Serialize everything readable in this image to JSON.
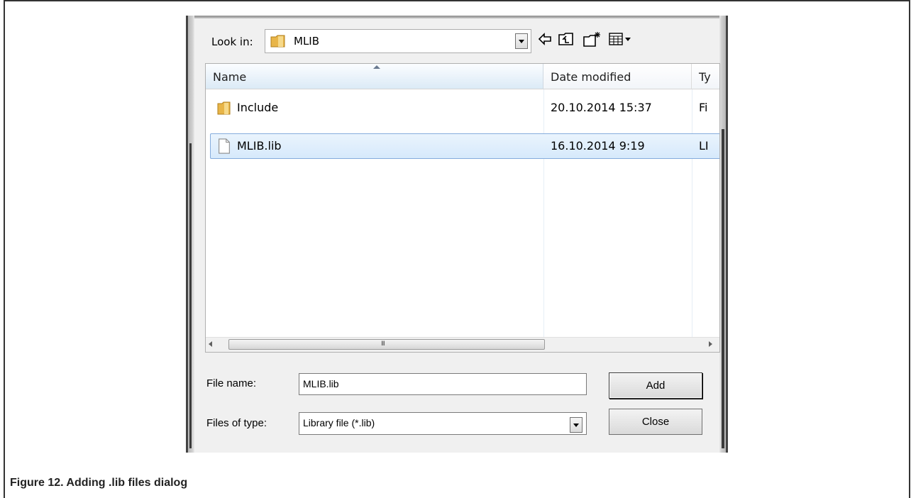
{
  "dialog": {
    "look_in_label": "Look in:",
    "look_in_value": "MLIB",
    "toolbar": {
      "back_icon": "back-arrow-icon",
      "up_icon": "up-folder-icon",
      "new_folder_icon": "new-folder-icon",
      "view_menu_icon": "view-menu-icon"
    },
    "columns": {
      "name": "Name",
      "date": "Date modified",
      "type": "Ty"
    },
    "files": [
      {
        "name": "Include",
        "date": "20.10.2014 15:37",
        "type": "Fi",
        "icon": "folder-icon",
        "selected": false
      },
      {
        "name": "MLIB.lib",
        "date": "16.10.2014 9:19",
        "type": "LI",
        "icon": "file-icon",
        "selected": true
      }
    ],
    "scroll_grip": "III",
    "file_name_label": "File name:",
    "file_name_value": "MLIB.lib",
    "files_of_type_label": "Files of type:",
    "files_of_type_value": "Library file (*.lib)",
    "add_button": "Add",
    "close_button": "Close"
  },
  "caption": "Figure 12. Adding .lib files dialog",
  "colors": {
    "selection": "#d6e9fb",
    "selection_border": "#84acdd",
    "dialog_bg": "#f0f0f0",
    "folder": "#e8b548"
  }
}
